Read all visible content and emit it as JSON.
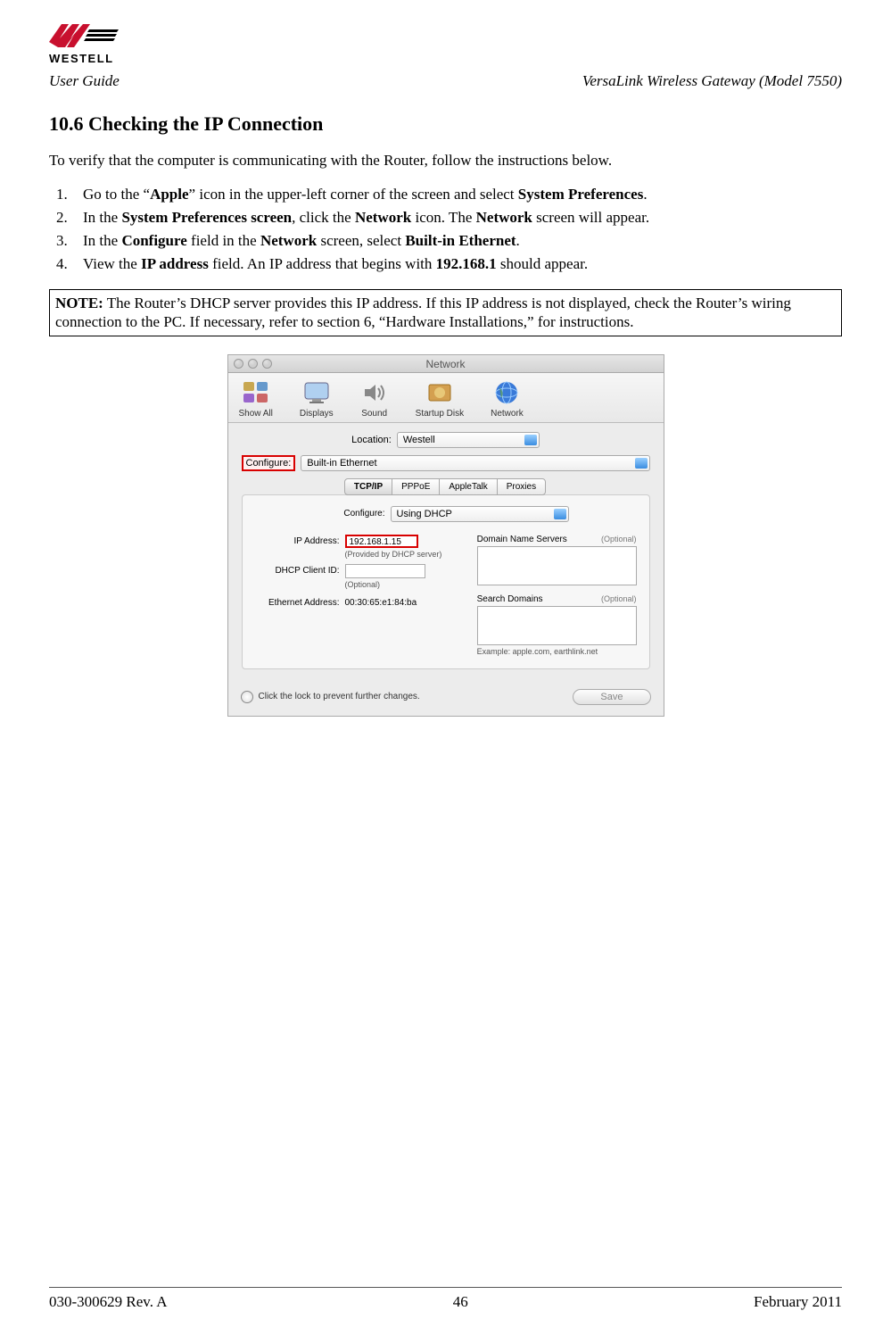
{
  "header": {
    "brand_text": "WESTELL",
    "left": "User Guide",
    "right": "VersaLink Wireless Gateway (Model 7550)"
  },
  "section": {
    "number": "10.6",
    "title": "Checking the IP Connection"
  },
  "intro": "To verify that the computer is communicating with the Router, follow the instructions below.",
  "steps": [
    {
      "num": "1.",
      "pre": "Go to the “",
      "b1": "Apple",
      "mid1": "” icon in the upper-left corner of the screen and select ",
      "b2": "System Preferences",
      "post": "."
    },
    {
      "num": "2.",
      "pre": "In the ",
      "b1": "System Preferences screen",
      "mid1": ", click the ",
      "b2": "Network",
      "mid2": " icon. The ",
      "b3": "Network",
      "post": " screen will appear."
    },
    {
      "num": "3.",
      "pre": "In the ",
      "b1": "Configure",
      "mid1": " field in the ",
      "b2": "Network",
      "mid2": " screen, select ",
      "b3": "Built-in Ethernet",
      "post": "."
    },
    {
      "num": "4.",
      "pre": "View the ",
      "b1": "IP address",
      "mid1": " field. An IP address that begins with ",
      "b2": "192.168.1",
      "post": " should appear."
    }
  ],
  "note": {
    "label": "NOTE:",
    "text": " The Router’s DHCP server provides this IP address. If this IP address is not displayed, check the Router’s wiring connection to the PC. If necessary, refer to section 6, “Hardware Installations,” for instructions."
  },
  "screenshot": {
    "window_title": "Network",
    "toolbar": [
      {
        "label": "Show All"
      },
      {
        "label": "Displays"
      },
      {
        "label": "Sound"
      },
      {
        "label": "Startup Disk"
      },
      {
        "label": "Network"
      }
    ],
    "location_label": "Location:",
    "location_value": "Westell",
    "configure_label": "Configure:",
    "configure_value": "Built-in Ethernet",
    "tabs": [
      "TCP/IP",
      "PPPoE",
      "AppleTalk",
      "Proxies"
    ],
    "inner_configure_label": "Configure:",
    "inner_configure_value": "Using DHCP",
    "ip_label": "IP Address:",
    "ip_value": "192.168.1.15",
    "ip_sub": "(Provided by DHCP server)",
    "dhcp_client_label": "DHCP Client ID:",
    "dhcp_client_sub": "(Optional)",
    "ethernet_label": "Ethernet Address:",
    "ethernet_value": "00:30:65:e1:84:ba",
    "dns_label": "Domain Name Servers",
    "optional": "(Optional)",
    "search_label": "Search Domains",
    "example": "Example: apple.com, earthlink.net",
    "lock_text": "Click the lock to prevent further changes.",
    "save_label": "Save"
  },
  "footer": {
    "left": "030-300629 Rev. A",
    "center": "46",
    "right": "February 2011"
  }
}
